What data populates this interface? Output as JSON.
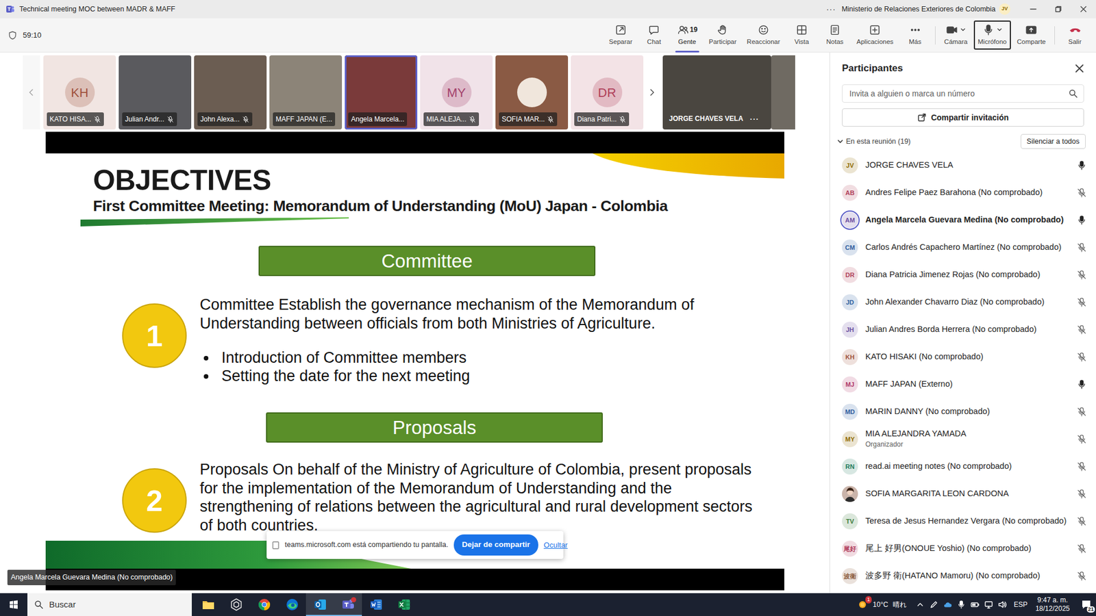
{
  "window": {
    "title": "Technical meeting MOC between MADR & MAFF",
    "more": "···",
    "account": "Ministerio de Relaciones Exteriores de Colombia",
    "avatar": "JV"
  },
  "toolbar": {
    "timer": "59:10",
    "buttons": [
      {
        "label": "Separar",
        "count": "",
        "selected": false,
        "outlined": false,
        "menu": false,
        "kind": "normal"
      },
      {
        "label": "Chat",
        "count": "",
        "selected": false,
        "outlined": false,
        "menu": false,
        "kind": "normal"
      },
      {
        "label": "Gente",
        "count": "19",
        "selected": true,
        "outlined": false,
        "menu": false,
        "kind": "normal"
      },
      {
        "label": "Participar",
        "count": "",
        "selected": false,
        "outlined": false,
        "menu": false,
        "kind": "normal"
      },
      {
        "label": "Reaccionar",
        "count": "",
        "selected": false,
        "outlined": false,
        "menu": false,
        "kind": "normal"
      },
      {
        "label": "Vista",
        "count": "",
        "selected": false,
        "outlined": false,
        "menu": false,
        "kind": "normal"
      },
      {
        "label": "Notas",
        "count": "",
        "selected": false,
        "outlined": false,
        "menu": false,
        "kind": "normal"
      },
      {
        "label": "Aplicaciones",
        "count": "",
        "selected": false,
        "outlined": false,
        "menu": false,
        "kind": "normal"
      },
      {
        "label": "Más",
        "count": "",
        "selected": false,
        "outlined": false,
        "menu": false,
        "kind": "normal"
      },
      {
        "label": "Cámara",
        "count": "",
        "selected": false,
        "outlined": false,
        "menu": true,
        "kind": "normal"
      },
      {
        "label": "Micrófono",
        "count": "",
        "selected": false,
        "outlined": true,
        "menu": true,
        "kind": "normal"
      },
      {
        "label": "Comparte",
        "count": "",
        "selected": false,
        "outlined": false,
        "menu": false,
        "kind": "normal"
      },
      {
        "label": "Salir",
        "count": "",
        "selected": false,
        "outlined": false,
        "menu": false,
        "kind": "leave"
      }
    ]
  },
  "video_strip": {
    "tiles": [
      {
        "label": "KATO HISA...",
        "kind": "initials",
        "initials": "KH",
        "muted": true,
        "speaking": false,
        "color": "#a0523d"
      },
      {
        "label": "Julian Andr...",
        "kind": "video",
        "initials": "",
        "muted": true,
        "speaking": false,
        "color": "#5a5a5e"
      },
      {
        "label": "John Alexa...",
        "kind": "video",
        "initials": "",
        "muted": true,
        "speaking": false,
        "color": "#6b5d52"
      },
      {
        "label": "MAFF JAPAN (E...",
        "kind": "video",
        "initials": "",
        "muted": false,
        "speaking": false,
        "color": "#8c8478"
      },
      {
        "label": "Angela Marcela...",
        "kind": "video",
        "initials": "",
        "muted": false,
        "speaking": true,
        "color": "#7a3a3a"
      },
      {
        "label": "MIA ALEJA...",
        "kind": "initials",
        "initials": "MY",
        "muted": true,
        "speaking": false,
        "color": "#a3406b"
      },
      {
        "label": "SOFIA MAR...",
        "kind": "photo",
        "initials": "",
        "muted": true,
        "speaking": false,
        "color": "#8a5a44"
      },
      {
        "label": "Diana Patri...",
        "kind": "initials",
        "initials": "DR",
        "muted": true,
        "speaking": false,
        "color": "#b0405a"
      }
    ],
    "self_tile": {
      "label": "JORGE CHAVES VELA",
      "more": "···",
      "color": "#4a4640"
    }
  },
  "slide": {
    "title": "OBJECTIVES",
    "subtitle": "First Committee Meeting: Memorandum of Understanding (MoU) Japan - Colombia",
    "sections": [
      {
        "number": "1",
        "heading": "Committee",
        "text": "Committee Establish the governance mechanism of the Memorandum of Understanding between officials from both Ministries of Agriculture.",
        "bullets": [
          "Introduction of Committee members",
          "Setting the date for the next meeting"
        ]
      },
      {
        "number": "2",
        "heading": "Proposals",
        "text": "Proposals On behalf of the Ministry of Agriculture of Colombia, present proposals for the implementation of the Memorandum of Understanding and the strengthening of relations between the agricultural and rural development sectors of both countries.",
        "bullets": []
      }
    ]
  },
  "share_notice": {
    "text": "teams.microsoft.com está compartiendo tu pantalla.",
    "stop": "Dejar de compartir",
    "hide": "Ocultar"
  },
  "presenter_label": "Angela Marcela Guevara Medina (No comprobado)",
  "participants_panel": {
    "title": "Participantes",
    "search": {
      "placeholder": "Invita a alguien o marca un número"
    },
    "invite": "Compartir invitación",
    "section": "En esta reunión (19)",
    "expanded": true,
    "mute_all": "Silenciar a todos",
    "people": [
      {
        "name": "JORGE CHAVES VELA",
        "role": "",
        "initials": "JV",
        "kind": "initials",
        "color": "#8f6b00",
        "muted": false,
        "speaking": false
      },
      {
        "name": "Andres Felipe Paez Barahona (No comprobado)",
        "role": "",
        "initials": "AB",
        "kind": "initials",
        "color": "#b0405a",
        "muted": true,
        "speaking": false
      },
      {
        "name": "Angela Marcela Guevara Medina (No comprobado)",
        "role": "",
        "initials": "AM",
        "kind": "initials",
        "color": "#6b4ea0",
        "muted": false,
        "speaking": true
      },
      {
        "name": "Carlos Andrés Capachero Martínez (No comprobado)",
        "role": "",
        "initials": "CM",
        "kind": "initials",
        "color": "#2f5f9e",
        "muted": true,
        "speaking": false
      },
      {
        "name": "Diana Patricia Jimenez Rojas (No comprobado)",
        "role": "",
        "initials": "DR",
        "kind": "initials",
        "color": "#b0405a",
        "muted": true,
        "speaking": false
      },
      {
        "name": "John Alexander Chavarro Diaz (No comprobado)",
        "role": "",
        "initials": "JD",
        "kind": "initials",
        "color": "#2f5f9e",
        "muted": true,
        "speaking": false
      },
      {
        "name": "Julian Andres Borda Herrera (No comprobado)",
        "role": "",
        "initials": "JH",
        "kind": "initials",
        "color": "#6b4ea0",
        "muted": true,
        "speaking": false
      },
      {
        "name": "KATO HISAKI (No comprobado)",
        "role": "",
        "initials": "KH",
        "kind": "initials",
        "color": "#a0523d",
        "muted": true,
        "speaking": false
      },
      {
        "name": "MAFF JAPAN (Externo)",
        "role": "",
        "initials": "MJ",
        "kind": "initials",
        "color": "#b03a6a",
        "muted": false,
        "speaking": false
      },
      {
        "name": "MARIN DANNY (No comprobado)",
        "role": "",
        "initials": "MD",
        "kind": "initials",
        "color": "#2f5f9e",
        "muted": true,
        "speaking": false
      },
      {
        "name": "MIA ALEJANDRA YAMADA",
        "role": "Organizador",
        "initials": "MY",
        "kind": "initials",
        "color": "#8f6b00",
        "muted": true,
        "speaking": false
      },
      {
        "name": "read.ai meeting notes (No comprobado)",
        "role": "",
        "initials": "RN",
        "kind": "initials",
        "color": "#1f7a5c",
        "muted": true,
        "speaking": false
      },
      {
        "name": "SOFIA MARGARITA LEON CARDONA",
        "role": "",
        "initials": "",
        "kind": "photo",
        "color": "#8a5a44",
        "muted": true,
        "speaking": false
      },
      {
        "name": "Teresa de Jesus Hernandez Vergara (No comprobado)",
        "role": "",
        "initials": "TV",
        "kind": "initials",
        "color": "#3a7a3a",
        "muted": true,
        "speaking": false
      },
      {
        "name": "尾上 好男(ONOUE Yoshio) (No comprobado)",
        "role": "",
        "initials": "尾好",
        "kind": "initials",
        "color": "#b03a5a",
        "muted": true,
        "speaking": false
      },
      {
        "name": "波多野 衛(HATANO Mamoru) (No comprobado)",
        "role": "",
        "initials": "波衛",
        "kind": "initials",
        "color": "#8a5a3a",
        "muted": true,
        "speaking": false
      }
    ]
  },
  "taskbar": {
    "search": "Buscar",
    "apps": [
      {
        "active": false,
        "badge": false
      },
      {
        "active": false,
        "badge": false
      },
      {
        "active": false,
        "badge": false
      },
      {
        "active": false,
        "badge": false
      },
      {
        "active": true,
        "badge": false
      },
      {
        "active": true,
        "badge": true
      },
      {
        "active": false,
        "badge": false
      },
      {
        "active": false,
        "badge": false
      }
    ],
    "weather": {
      "badge": "1",
      "temp": "10°C",
      "condition": "晴れ"
    },
    "language": "ESP",
    "time": "9:47 a. m.",
    "date": "18/12/2025",
    "notifications": "21"
  }
}
